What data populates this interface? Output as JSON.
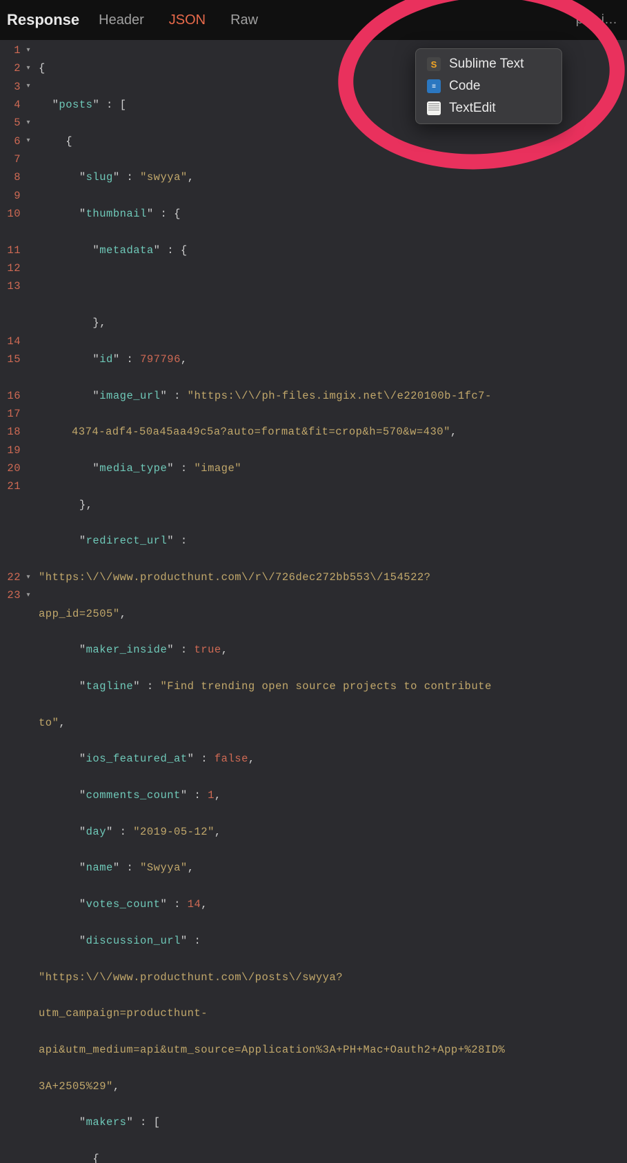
{
  "topbar": {
    "title": "Response",
    "tabs": {
      "header": "Header",
      "json": "JSON",
      "raw": "Raw"
    },
    "open_in": "pen i…"
  },
  "ctxmenu": {
    "sublime": "Sublime Text",
    "code": "Code",
    "textedit": "TextEdit"
  },
  "gutter": {
    "l1": "1",
    "l2": "2",
    "l3": "3",
    "l4": "4",
    "l5": "5",
    "l6": "6",
    "l7": "7",
    "l8": "8",
    "l9": "9",
    "l10": "10",
    "l11": "11",
    "l12": "12",
    "l13": "13",
    "l14": "14",
    "l15": "15",
    "l16": "16",
    "l17": "17",
    "l18": "18",
    "l19": "19",
    "l20": "20",
    "l21": "21",
    "l22": "22",
    "l23": "23"
  },
  "code": {
    "l1": {
      "p1": "{"
    },
    "l2": {
      "i": "  ",
      "q": "\"",
      "k": "posts",
      "q2": "\"",
      "sep": " : ",
      "b": "["
    },
    "l3": {
      "i": "    ",
      "b": "{"
    },
    "l4": {
      "i": "      ",
      "q": "\"",
      "k": "slug",
      "q2": "\"",
      "sep": " : ",
      "v": "\"swyya\"",
      "c": ","
    },
    "l5": {
      "i": "      ",
      "q": "\"",
      "k": "thumbnail",
      "q2": "\"",
      "sep": " : ",
      "b": "{"
    },
    "l6": {
      "i": "        ",
      "q": "\"",
      "k": "metadata",
      "q2": "\"",
      "sep": " : ",
      "b": "{"
    },
    "l7": {
      "i": ""
    },
    "l8": {
      "i": "        ",
      "b": "}",
      "c": ","
    },
    "l9": {
      "i": "        ",
      "q": "\"",
      "k": "id",
      "q2": "\"",
      "sep": " : ",
      "v": "797796",
      "c": ","
    },
    "l10": {
      "i": "        ",
      "q": "\"",
      "k": "image_url",
      "q2": "\"",
      "sep": " : ",
      "v1": "\"https:\\/\\/ph-files.imgix.net\\/e220100b-1fc7-",
      "v2": "4374-adf4-50a45aa49c5a?auto=format&fit=crop&h=570&w=430\"",
      "c": ","
    },
    "l11": {
      "i": "        ",
      "q": "\"",
      "k": "media_type",
      "q2": "\"",
      "sep": " : ",
      "v": "\"image\""
    },
    "l12": {
      "i": "      ",
      "b": "}",
      "c": ","
    },
    "l13": {
      "i": "      ",
      "q": "\"",
      "k": "redirect_url",
      "q2": "\"",
      "sep": " : "
    },
    "l13c1": "\"https:\\/\\/www.producthunt.com\\/r\\/726dec272bb553\\/154522?",
    "l13c2": "app_id=2505\"",
    "l13cend": ",",
    "l14": {
      "i": "      ",
      "q": "\"",
      "k": "maker_inside",
      "q2": "\"",
      "sep": " : ",
      "v": "true",
      "c": ","
    },
    "l15": {
      "i": "      ",
      "q": "\"",
      "k": "tagline",
      "q2": "\"",
      "sep": " : ",
      "v1": "\"Find trending open source projects to contribute ",
      "v2": "to\"",
      "c": ","
    },
    "l16": {
      "i": "      ",
      "q": "\"",
      "k": "ios_featured_at",
      "q2": "\"",
      "sep": " : ",
      "v": "false",
      "c": ","
    },
    "l17": {
      "i": "      ",
      "q": "\"",
      "k": "comments_count",
      "q2": "\"",
      "sep": " : ",
      "v": "1",
      "c": ","
    },
    "l18": {
      "i": "      ",
      "q": "\"",
      "k": "day",
      "q2": "\"",
      "sep": " : ",
      "v": "\"2019-05-12\"",
      "c": ","
    },
    "l19": {
      "i": "      ",
      "q": "\"",
      "k": "name",
      "q2": "\"",
      "sep": " : ",
      "v": "\"Swyya\"",
      "c": ","
    },
    "l20": {
      "i": "      ",
      "q": "\"",
      "k": "votes_count",
      "q2": "\"",
      "sep": " : ",
      "v": "14",
      "c": ","
    },
    "l21": {
      "i": "      ",
      "q": "\"",
      "k": "discussion_url",
      "q2": "\"",
      "sep": " : "
    },
    "l21c1": "\"https:\\/\\/www.producthunt.com\\/posts\\/swyya?",
    "l21c2": "utm_campaign=producthunt-",
    "l21c3": "api&utm_medium=api&utm_source=Application%3A+PH+Mac+Oauth2+App+%28ID%",
    "l21c4": "3A+2505%29\"",
    "l21cend": ",",
    "l22": {
      "i": "      ",
      "q": "\"",
      "k": "makers",
      "q2": "\"",
      "sep": " : ",
      "b": "["
    },
    "l23": {
      "i": "        ",
      "b": "{"
    }
  }
}
